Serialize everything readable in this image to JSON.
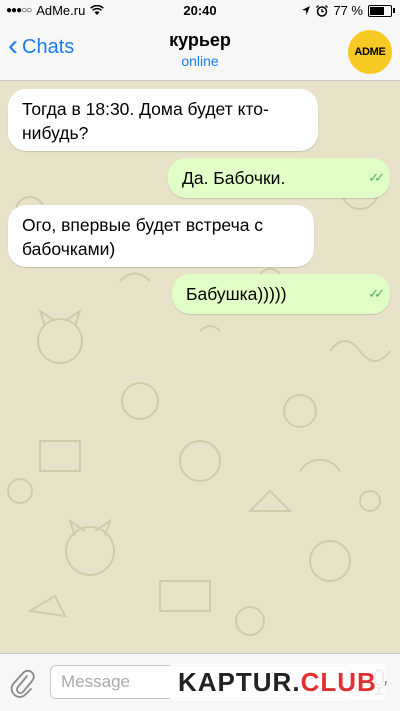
{
  "status_bar": {
    "signal": "●●●○○",
    "carrier": "AdMe.ru",
    "time": "20:40",
    "battery_text": "77 %",
    "battery_level": 0.77
  },
  "nav": {
    "back_label": "Chats",
    "contact_name": "курьер",
    "contact_status": "online",
    "avatar_text": "ADME"
  },
  "messages": [
    {
      "direction": "in",
      "text": "Тогда в 18:30. Дома будет кто-нибудь?"
    },
    {
      "direction": "out",
      "text": "Да. Бабочки.",
      "ticks": "✓✓"
    },
    {
      "direction": "in",
      "text": "Ого, впервые будет встреча с бабочками)"
    },
    {
      "direction": "out",
      "text": "Бабушка)))))",
      "ticks": "✓✓"
    }
  ],
  "input": {
    "placeholder": "Message"
  },
  "watermark": {
    "main": "KAPTUR.",
    "accent": "CLUB"
  },
  "colors": {
    "accent": "#1a7cf5",
    "incoming_bubble": "#ffffff",
    "outgoing_bubble": "#e1fec6",
    "chat_background": "#e8e3c8",
    "avatar_bg": "#f7c923"
  }
}
